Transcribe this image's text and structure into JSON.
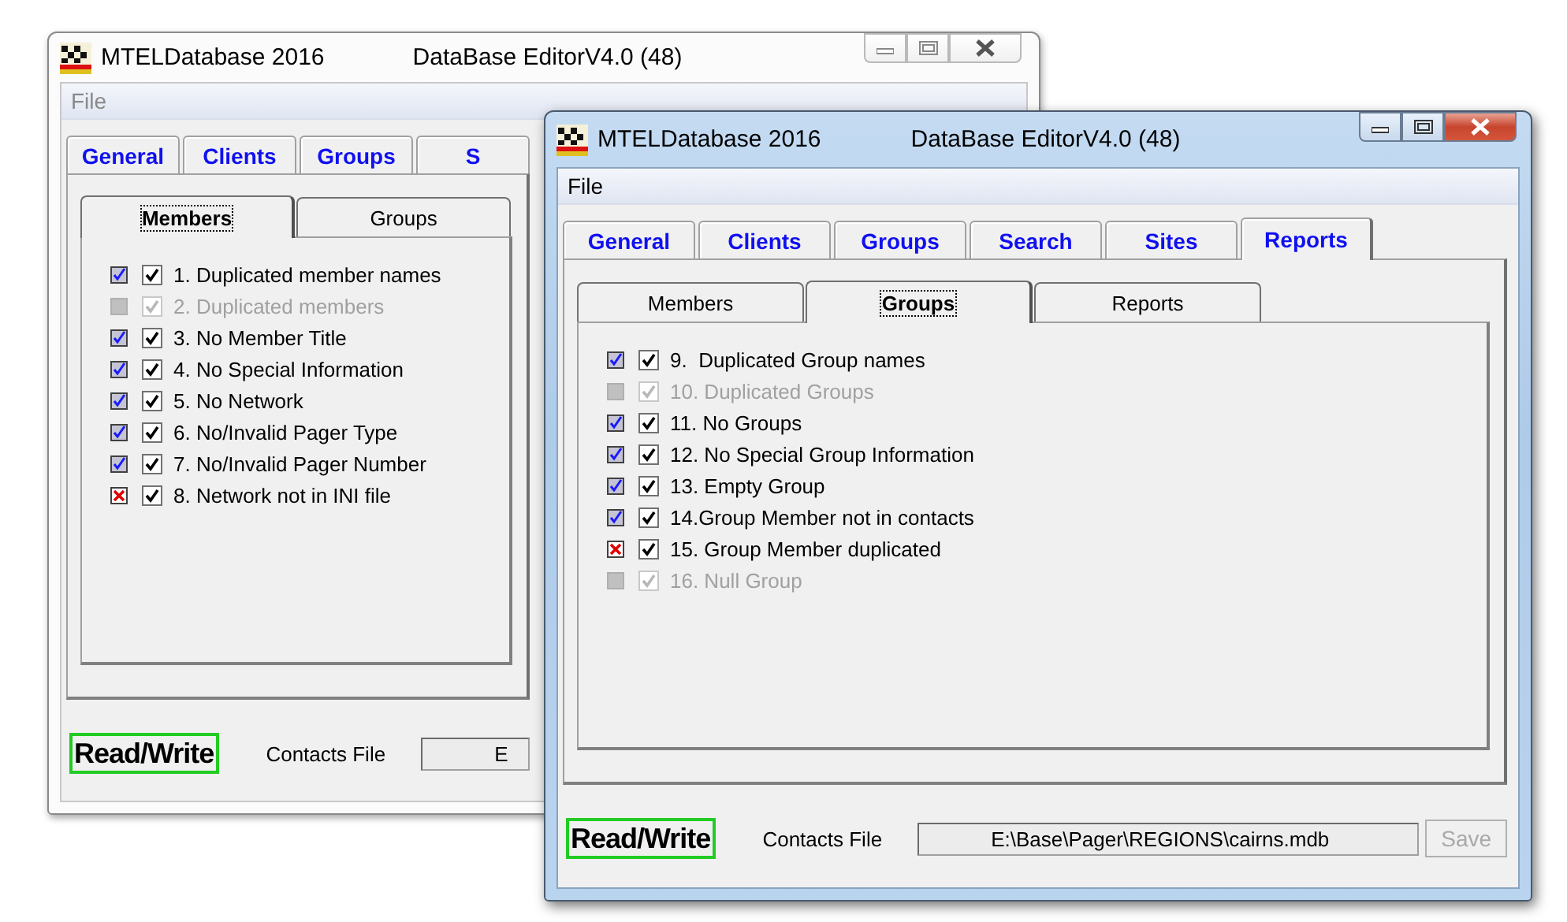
{
  "windows": [
    {
      "active": false,
      "app_name": "MTELDatabase 2016",
      "title": "DataBase EditorV4.0 (48)",
      "menu": [
        "File"
      ],
      "tabs": [
        {
          "label": "General",
          "selected": false
        },
        {
          "label": "Clients",
          "selected": false
        },
        {
          "label": "Groups",
          "selected": false
        },
        {
          "label": "S",
          "selected": false
        }
      ],
      "subtabs": [
        {
          "label": "Members",
          "selected": true
        },
        {
          "label": "Groups",
          "selected": false
        }
      ],
      "checks": [
        {
          "label": "1. Duplicated member names",
          "kind": "pass",
          "checked": true,
          "disabled": false
        },
        {
          "label": "2. Duplicated members",
          "kind": "blank",
          "checked": true,
          "disabled": true
        },
        {
          "label": "3. No Member Title",
          "kind": "pass",
          "checked": true,
          "disabled": false
        },
        {
          "label": "4. No Special Information",
          "kind": "pass",
          "checked": true,
          "disabled": false
        },
        {
          "label": "5. No Network",
          "kind": "pass",
          "checked": true,
          "disabled": false
        },
        {
          "label": "6. No/Invalid Pager Type",
          "kind": "pass",
          "checked": true,
          "disabled": false
        },
        {
          "label": "7. No/Invalid Pager Number",
          "kind": "pass",
          "checked": true,
          "disabled": false
        },
        {
          "label": "8. Network not in INI file",
          "kind": "fail",
          "checked": true,
          "disabled": false
        }
      ],
      "mode": "Read/Write",
      "contacts_label": "Contacts File",
      "contacts_file": "E"
    },
    {
      "active": true,
      "app_name": "MTELDatabase 2016",
      "title": "DataBase EditorV4.0 (48)",
      "menu": [
        "File"
      ],
      "tabs": [
        {
          "label": "General",
          "selected": false
        },
        {
          "label": "Clients",
          "selected": false
        },
        {
          "label": "Groups",
          "selected": false
        },
        {
          "label": "Search",
          "selected": false
        },
        {
          "label": "Sites",
          "selected": false
        },
        {
          "label": "Reports",
          "selected": true
        }
      ],
      "subtabs": [
        {
          "label": "Members",
          "selected": false
        },
        {
          "label": "Groups",
          "selected": true
        },
        {
          "label": "Reports",
          "selected": false
        }
      ],
      "checks": [
        {
          "label": "9.  Duplicated Group names",
          "kind": "pass",
          "checked": true,
          "disabled": false
        },
        {
          "label": "10. Duplicated Groups",
          "kind": "blank",
          "checked": true,
          "disabled": true
        },
        {
          "label": "11. No Groups",
          "kind": "pass",
          "checked": true,
          "disabled": false
        },
        {
          "label": "12. No Special Group Information",
          "kind": "pass",
          "checked": true,
          "disabled": false
        },
        {
          "label": "13. Empty Group",
          "kind": "pass",
          "checked": true,
          "disabled": false
        },
        {
          "label": "14.Group Member not in contacts",
          "kind": "pass",
          "checked": true,
          "disabled": false
        },
        {
          "label": "15. Group Member duplicated",
          "kind": "fail",
          "checked": true,
          "disabled": false
        },
        {
          "label": "16. Null Group",
          "kind": "blank",
          "checked": true,
          "disabled": true
        }
      ],
      "mode": "Read/Write",
      "contacts_label": "Contacts File",
      "contacts_file": "E:\\Base\\Pager\\REGIONS\\cairns.mdb",
      "save": {
        "label": "Save",
        "disabled": true
      }
    }
  ]
}
